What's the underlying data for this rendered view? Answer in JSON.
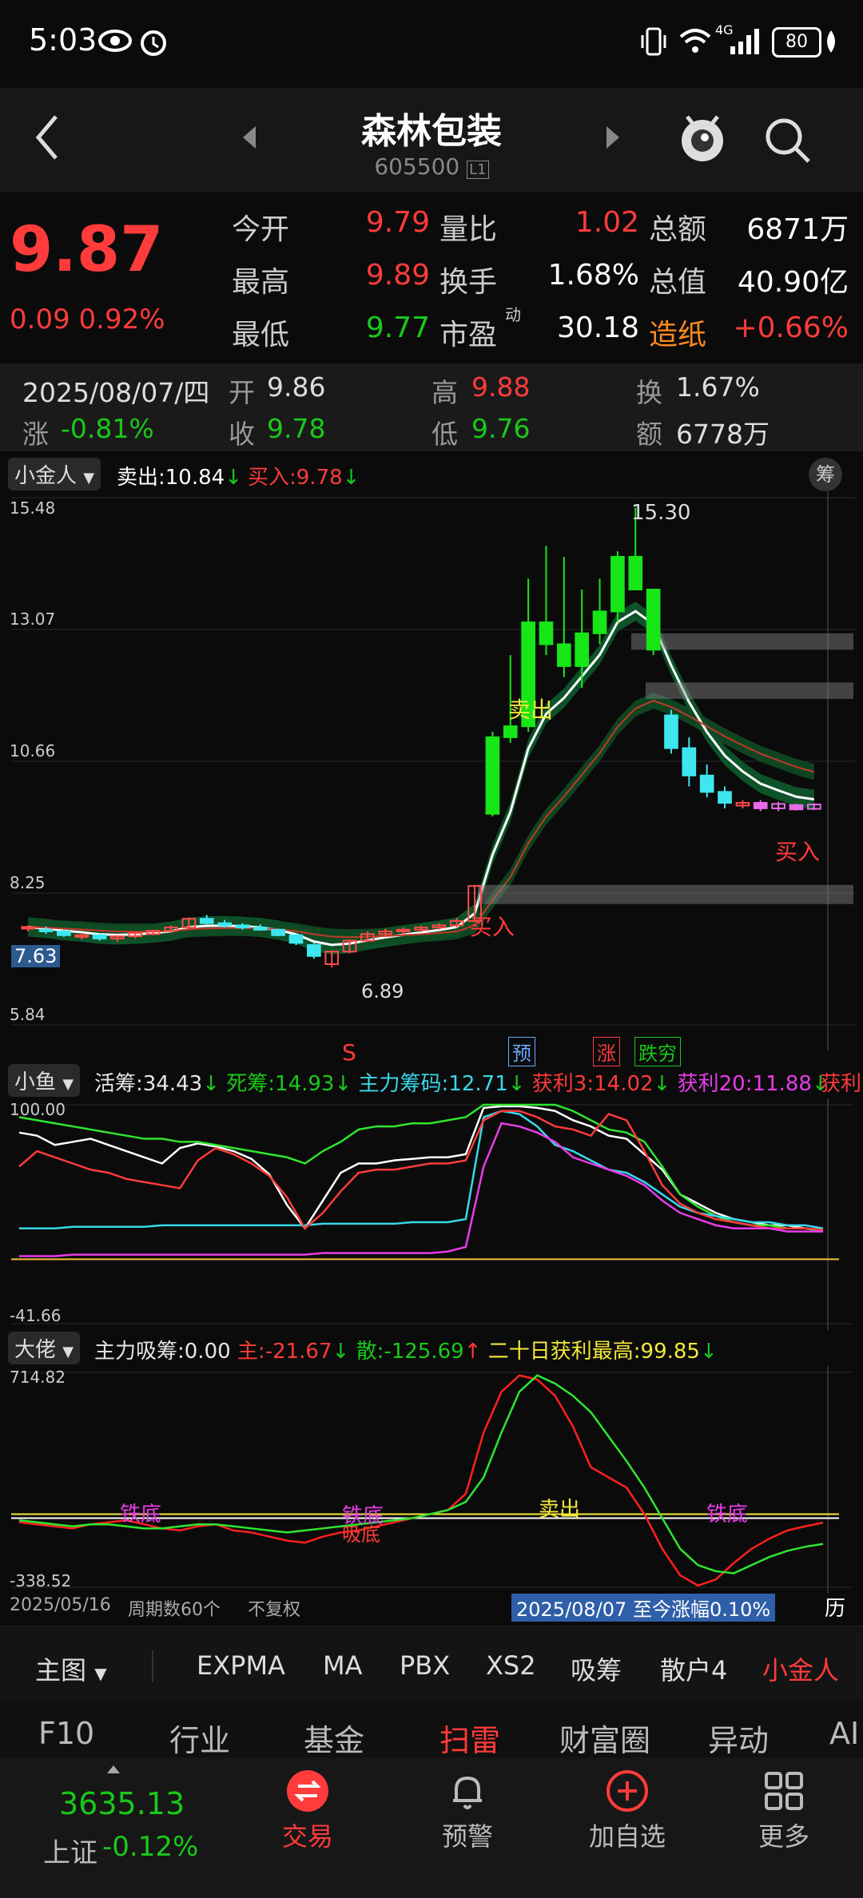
{
  "status": {
    "time": "5:03",
    "network": "4G",
    "battery": "80"
  },
  "header": {
    "name": "森林包装",
    "code": "605500",
    "code_badge": "L1"
  },
  "quote": {
    "price": "9.87",
    "change": "0.09",
    "change_pct": "0.92%",
    "rows": [
      [
        {
          "label": "今开",
          "value": "9.79",
          "color": "red"
        },
        {
          "label": "量比",
          "value": "1.02",
          "color": "red"
        },
        {
          "label": "总额",
          "value": "6871万",
          "color": "white"
        }
      ],
      [
        {
          "label": "最高",
          "value": "9.89",
          "color": "red"
        },
        {
          "label": "换手",
          "value": "1.68%",
          "color": "white"
        },
        {
          "label": "总值",
          "value": "40.90亿",
          "color": "white"
        }
      ],
      [
        {
          "label": "最低",
          "value": "9.77",
          "color": "green"
        },
        {
          "label": "市盈",
          "value": "30.18",
          "color": "white"
        },
        {
          "label": "造纸",
          "value": "+0.66%",
          "color": "red"
        }
      ]
    ],
    "pe_sup": "动"
  },
  "day": {
    "date": "2025/08/07/四",
    "open_label": "开",
    "open": "9.86",
    "high_label": "高",
    "high": "9.88",
    "turn_label": "换",
    "turn": "1.67%",
    "chg_label": "涨",
    "chg": "-0.81%",
    "close_label": "收",
    "close": "9.78",
    "low_label": "低",
    "low": "9.76",
    "amt_label": "额",
    "amt": "6778万"
  },
  "main_chart": {
    "indicator": "小金人",
    "sell_label": "卖出:",
    "sell_value": "10.84",
    "buy_label": "买入:",
    "buy_value": "9.78",
    "chip_button": "筹",
    "y_ticks": [
      "15.48",
      "13.07",
      "10.66",
      "8.25",
      "5.84"
    ],
    "current_price_tag": "7.63",
    "high_label": "15.30",
    "low_label": "6.89",
    "annotations": {
      "sell": "卖出",
      "buy1": "买入",
      "buy2": "买入",
      "s": "S",
      "yu": "预",
      "zhang": "涨",
      "diedang": "跌穷"
    }
  },
  "chart_data": [
    {
      "type": "candlestick",
      "title": "",
      "ylim": [
        5.84,
        15.48
      ],
      "ohlc": [
        [
          7.6,
          7.66,
          7.55,
          7.63
        ],
        [
          7.58,
          7.64,
          7.5,
          7.55
        ],
        [
          7.55,
          7.58,
          7.45,
          7.48
        ],
        [
          7.45,
          7.52,
          7.4,
          7.48
        ],
        [
          7.48,
          7.5,
          7.38,
          7.42
        ],
        [
          7.42,
          7.48,
          7.36,
          7.46
        ],
        [
          7.46,
          7.54,
          7.42,
          7.52
        ],
        [
          7.5,
          7.58,
          7.48,
          7.56
        ],
        [
          7.56,
          7.66,
          7.52,
          7.62
        ],
        [
          7.62,
          7.8,
          7.6,
          7.78
        ],
        [
          7.78,
          7.85,
          7.68,
          7.7
        ],
        [
          7.7,
          7.76,
          7.62,
          7.66
        ],
        [
          7.66,
          7.7,
          7.58,
          7.62
        ],
        [
          7.62,
          7.68,
          7.56,
          7.58
        ],
        [
          7.58,
          7.6,
          7.46,
          7.48
        ],
        [
          7.48,
          7.5,
          7.3,
          7.34
        ],
        [
          7.3,
          7.34,
          7.05,
          7.1
        ],
        [
          6.95,
          7.2,
          6.89,
          7.18
        ],
        [
          7.18,
          7.4,
          7.15,
          7.38
        ],
        [
          7.38,
          7.55,
          7.35,
          7.5
        ],
        [
          7.5,
          7.6,
          7.45,
          7.55
        ],
        [
          7.55,
          7.62,
          7.5,
          7.58
        ],
        [
          7.58,
          7.66,
          7.54,
          7.62
        ],
        [
          7.62,
          7.7,
          7.58,
          7.66
        ],
        [
          7.66,
          7.8,
          7.62,
          7.74
        ],
        [
          7.74,
          8.4,
          7.72,
          8.38
        ],
        [
          9.7,
          11.2,
          9.65,
          11.1
        ],
        [
          11.1,
          12.6,
          11.0,
          11.3
        ],
        [
          11.3,
          14.0,
          11.2,
          13.2
        ],
        [
          13.2,
          14.6,
          12.6,
          12.8
        ],
        [
          12.8,
          14.4,
          12.2,
          12.4
        ],
        [
          12.4,
          13.8,
          12.0,
          13.0
        ],
        [
          13.0,
          14.0,
          12.8,
          13.4
        ],
        [
          13.4,
          14.5,
          13.2,
          14.4
        ],
        [
          14.4,
          15.3,
          13.8,
          13.8
        ],
        [
          13.8,
          13.6,
          12.6,
          12.7
        ],
        [
          11.5,
          11.6,
          10.8,
          10.9
        ],
        [
          10.9,
          11.1,
          10.2,
          10.4
        ],
        [
          10.4,
          10.6,
          10.0,
          10.1
        ],
        [
          10.1,
          10.2,
          9.8,
          9.9
        ],
        [
          9.85,
          9.95,
          9.8,
          9.9
        ],
        [
          9.9,
          9.95,
          9.75,
          9.8
        ],
        [
          9.8,
          9.92,
          9.75,
          9.88
        ],
        [
          9.86,
          9.88,
          9.76,
          9.78
        ],
        [
          9.79,
          9.89,
          9.77,
          9.87
        ]
      ]
    },
    {
      "type": "line",
      "title": "",
      "ylim": [
        -41.66,
        100.0
      ],
      "series": [
        {
          "name": "活筹",
          "values": [
            82,
            80,
            74,
            76,
            78,
            74,
            70,
            66,
            62,
            72,
            75,
            73,
            70,
            65,
            55,
            35,
            20,
            38,
            56,
            62,
            62,
            64,
            65,
            66,
            66,
            68,
            98,
            99,
            99,
            98,
            96,
            90,
            86,
            80,
            78,
            68,
            58,
            42,
            36,
            30,
            26,
            24,
            22,
            22,
            20,
            19
          ]
        },
        {
          "name": "死筹",
          "values": [
            92,
            90,
            88,
            86,
            84,
            82,
            80,
            78,
            78,
            76,
            76,
            74,
            72,
            70,
            68,
            66,
            62,
            70,
            76,
            84,
            86,
            86,
            88,
            88,
            90,
            92,
            100,
            100,
            100,
            100,
            100,
            96,
            90,
            84,
            82,
            76,
            60,
            42,
            34,
            28,
            24,
            22,
            22,
            20,
            20,
            18
          ]
        },
        {
          "name": "主力筹码",
          "values": [
            20,
            20,
            20,
            21,
            21,
            21,
            21,
            21,
            22,
            22,
            22,
            22,
            22,
            22,
            22,
            22,
            22,
            23,
            23,
            23,
            23,
            23,
            24,
            24,
            24,
            26,
            92,
            96,
            94,
            86,
            74,
            70,
            64,
            58,
            56,
            50,
            42,
            34,
            30,
            28,
            26,
            24,
            24,
            22,
            22,
            20
          ]
        },
        {
          "name": "获利3",
          "values": [
            60,
            70,
            66,
            62,
            58,
            56,
            52,
            50,
            48,
            46,
            64,
            72,
            68,
            62,
            54,
            40,
            20,
            30,
            44,
            56,
            58,
            58,
            60,
            62,
            62,
            64,
            90,
            96,
            96,
            92,
            86,
            84,
            80,
            94,
            90,
            70,
            48,
            36,
            30,
            26,
            24,
            22,
            20,
            20,
            20,
            19
          ]
        },
        {
          "name": "获利20",
          "values": [
            2,
            2,
            2,
            3,
            3,
            3,
            3,
            3,
            3,
            3,
            3,
            3,
            3,
            3,
            3,
            3,
            3,
            4,
            4,
            4,
            4,
            4,
            4,
            4,
            5,
            8,
            60,
            88,
            86,
            82,
            76,
            66,
            62,
            58,
            54,
            48,
            38,
            30,
            26,
            22,
            20,
            20,
            20,
            18,
            18,
            18
          ]
        }
      ]
    },
    {
      "type": "line",
      "title": "",
      "ylim": [
        -338.52,
        714.82
      ],
      "series": [
        {
          "name": "主",
          "values": [
            -20,
            -30,
            -40,
            -50,
            -30,
            -20,
            -10,
            -30,
            -50,
            -60,
            -40,
            -30,
            -60,
            -70,
            -90,
            -110,
            -120,
            -90,
            -70,
            -60,
            -40,
            -20,
            0,
            20,
            40,
            120,
            420,
            620,
            700,
            680,
            600,
            450,
            250,
            200,
            150,
            20,
            -150,
            -280,
            -330,
            -300,
            -220,
            -150,
            -100,
            -60,
            -40,
            -22
          ]
        },
        {
          "name": "散",
          "values": [
            -10,
            -20,
            -30,
            -40,
            -30,
            -30,
            -40,
            -50,
            -50,
            -40,
            -30,
            -30,
            -40,
            -50,
            -60,
            -70,
            -60,
            -50,
            -40,
            -30,
            -20,
            -10,
            0,
            20,
            40,
            80,
            200,
            420,
            620,
            700,
            660,
            600,
            520,
            400,
            280,
            150,
            0,
            -150,
            -230,
            -260,
            -270,
            -230,
            -190,
            -160,
            -140,
            -126
          ]
        }
      ]
    }
  ],
  "sub1": {
    "indicator": "小鱼",
    "y_top": "100.00",
    "y_bottom": "-41.66",
    "items": [
      {
        "label": "活筹:",
        "value": "34.43",
        "color": "white",
        "arrow": "↓"
      },
      {
        "label": "死筹:",
        "value": "14.93",
        "color": "green",
        "arrow": "↓"
      },
      {
        "label": "主力筹码:",
        "value": "12.71",
        "color": "cyan",
        "arrow": "↓"
      },
      {
        "label": "获利3:",
        "value": "14.02",
        "color": "red",
        "arrow": "↓"
      },
      {
        "label": "获利20:",
        "value": "11.88",
        "color": "magenta",
        "arrow": "↓"
      },
      {
        "label": "获利",
        "value": "",
        "color": "red",
        "arrow": ""
      }
    ]
  },
  "sub2": {
    "indicator": "大佬",
    "y_top": "714.82",
    "y_bottom": "-338.52",
    "items": [
      {
        "label": "主力吸筹:",
        "value": "0.00",
        "color": "white",
        "arrow": ""
      },
      {
        "label": "主:",
        "value": "-21.67",
        "color": "red",
        "arrow": "↓"
      },
      {
        "label": "散:",
        "value": "-125.69",
        "color": "green",
        "arrow": "↑"
      },
      {
        "label": "二十日获利最高:",
        "value": "99.85",
        "color": "yellow",
        "arrow": "↓"
      }
    ],
    "annotations": {
      "tiedi1": "铁底",
      "tiedi2": "铁底",
      "tiedi3": "铁底",
      "xidi": "吸底",
      "maichu": "卖出"
    }
  },
  "footer_info": {
    "start_date": "2025/05/16",
    "period": "周期数60个",
    "adjust": "不复权",
    "range_text": "2025/08/07 至今涨幅0.10%",
    "hist_button": "历"
  },
  "indicator_tabs": {
    "main": "主图",
    "items": [
      "EXPMA",
      "MA",
      "PBX",
      "XS2",
      "吸筹",
      "散户4",
      "小金人"
    ],
    "active": "小金人"
  },
  "nav_tabs": {
    "items": [
      "F10",
      "行业",
      "基金",
      "扫雷",
      "财富圈",
      "异动",
      "AI"
    ],
    "active": "扫雷"
  },
  "bottom": {
    "index_value": "3635.13",
    "index_name": "上证",
    "index_change": "-0.12%",
    "items": [
      {
        "label": "交易",
        "icon": "trade-icon"
      },
      {
        "label": "预警",
        "icon": "bell-icon"
      },
      {
        "label": "加自选",
        "icon": "add-circle-icon"
      },
      {
        "label": "更多",
        "icon": "grid-icon"
      }
    ]
  }
}
